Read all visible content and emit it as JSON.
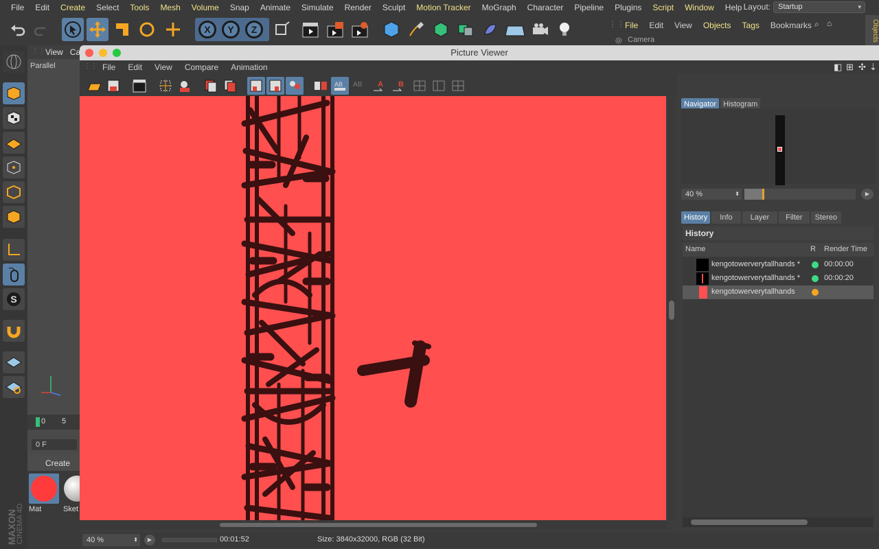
{
  "menubar": {
    "items": [
      "File",
      "Edit",
      "Create",
      "Select",
      "Tools",
      "Mesh",
      "Volume",
      "Snap",
      "Animate",
      "Simulate",
      "Render",
      "Sculpt",
      "Motion Tracker",
      "MoGraph",
      "Character",
      "Pipeline",
      "Plugins",
      "Script",
      "Window",
      "Help"
    ],
    "highlighted": [
      "Create",
      "Tools",
      "Mesh",
      "Volume",
      "Motion Tracker",
      "Script",
      "Window"
    ],
    "layout_label": "Layout:",
    "layout_value": "Startup"
  },
  "toolbar": {
    "axis_labels": [
      "X",
      "Y",
      "Z"
    ]
  },
  "object_manager": {
    "menu": [
      "File",
      "Edit",
      "View",
      "Objects",
      "Tags",
      "Bookmarks"
    ],
    "highlighted": [
      "File",
      "Objects",
      "Tags"
    ],
    "camera_label": "Camera",
    "side_tab": "Objects"
  },
  "viewport": {
    "menu": [
      "View",
      "Ca"
    ],
    "mode": "Parallel",
    "timeline_ticks": [
      "0",
      "5"
    ],
    "frame_value": "0 F"
  },
  "material_manager": {
    "header": "Create",
    "materials": [
      {
        "label": "Mat",
        "color": "#ff3b3b"
      },
      {
        "label": "Sket",
        "color": "#d8d8d8"
      }
    ]
  },
  "brand": {
    "line1": "MAXON",
    "line2": "CINEMA 4D"
  },
  "picture_viewer": {
    "title": "Picture Viewer",
    "menu": [
      "File",
      "Edit",
      "View",
      "Compare",
      "Animation"
    ],
    "canvas_color": "#ff4f4f",
    "status": {
      "zoom": "40 %",
      "time": "00:01:52",
      "size": "Size: 3840x32000, RGB (32 Bit)"
    }
  },
  "navigator": {
    "tabs": [
      "Navigator",
      "Histogram"
    ],
    "active_tab": "Navigator",
    "zoom": "40 %",
    "zoom_fraction": 0.16
  },
  "history": {
    "tabs": [
      "History",
      "Info",
      "Layer",
      "Filter",
      "Stereo"
    ],
    "active_tab": "History",
    "heading": "History",
    "columns": {
      "name": "Name",
      "r": "R",
      "render_time": "Render Time"
    },
    "rows": [
      {
        "name": "kengotowerverytallhands *",
        "status_color": "#3ddc84",
        "render_time": "00:00:00",
        "selected": false
      },
      {
        "name": "kengotowerverytallhands *",
        "status_color": "#3ddc84",
        "render_time": "00:00:20",
        "selected": false
      },
      {
        "name": "kengotowerverytallhands",
        "status_color": "#f5a623",
        "render_time": "",
        "selected": true
      }
    ]
  }
}
